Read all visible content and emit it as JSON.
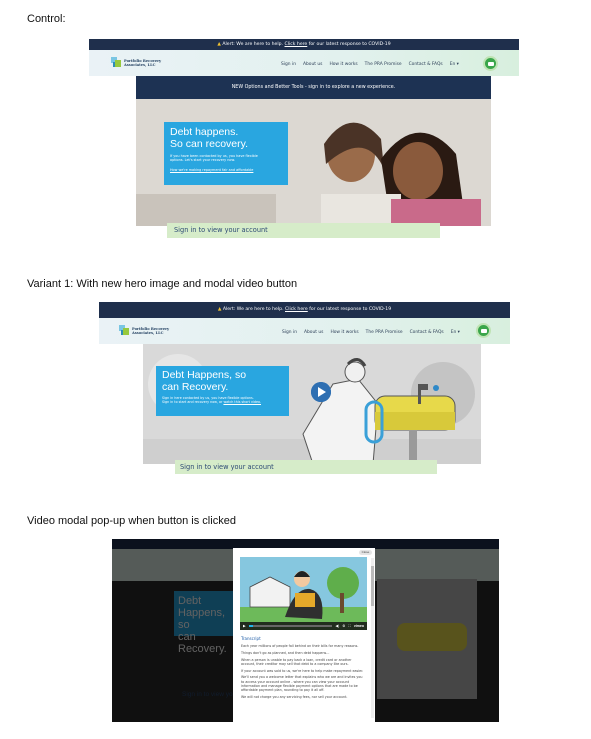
{
  "labels": {
    "control": "Control:",
    "variant": "Variant 1: With new hero image and modal video button",
    "modal": "Video modal pop-up when button is clicked"
  },
  "site": {
    "alert_prefix": "Alert: We are here to help.",
    "alert_link": "Click here",
    "alert_suffix": "for our latest response to COVID-19",
    "logo_line1": "Portfolio Recovery",
    "logo_line2": "Associates, LLC",
    "nav": [
      "Sign in",
      "About us",
      "How it works",
      "The PRA Promise",
      "Contact & FAQs",
      "En"
    ],
    "signin_strip": "Sign in to view your account"
  },
  "control": {
    "promo": "NEW Options and Better Tools - sign in to explore a new experience.",
    "headline1": "Debt happens.",
    "headline2": "So can recovery.",
    "body1": "If you have been contacted by us, you have flexible",
    "body2": "options. Let's start your recovery now.",
    "link": "How we're making repayment fair and affordable"
  },
  "variant": {
    "headline1": "Debt Happens, so",
    "headline2": "can Recovery.",
    "body1": "Sign in here contacted by us, you have flexible options.",
    "body2": "Sign in to start and recovery now, or",
    "body_link": "watch this short video."
  },
  "modal": {
    "close": "Close",
    "video_brand": "vimeo",
    "progress": 0.05,
    "transcript_title": "Transcript",
    "paragraphs": [
      "Each year millions of people fall behind on their bills for many reasons.",
      "Things don't go as planned, and then debt happens...",
      "When a person is unable to pay back a loan, credit card or another account, their creditor may sell that debt to a company like ours.",
      "If your account was sold to us, we're here to help make repayment easier.",
      "We'll send you a welcome letter that explains who we are and invites you to access your account online - where you can view your account information and manage flexible payment options that are made to be affordable payment plan, rounding to pay it all off.",
      "We will not charge you any servicing fees, nor sell your account."
    ]
  },
  "colors": {
    "navy": "#1f2f4c",
    "hero_blue": "#29a6e0",
    "signin_green": "#d6ecc9",
    "chat_green": "#3aa64a",
    "mailbox_yellow": "#e7d94a"
  }
}
